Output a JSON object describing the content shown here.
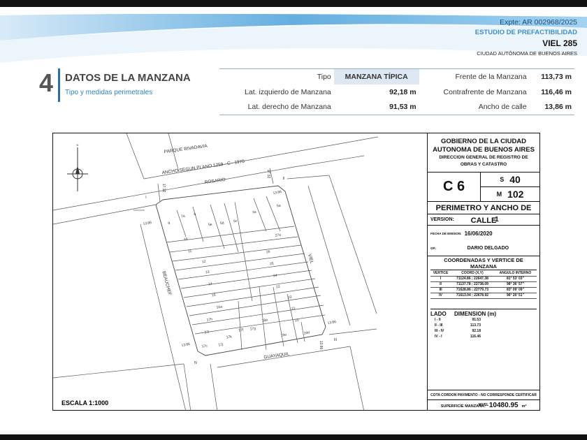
{
  "header": {
    "expediente": "Expte: AR 002968/2025",
    "estudio": "ESTUDIO DE PREFACTIBILIDAD",
    "direccion": "VIEL 285",
    "ciudad": "CIUDAD AUTÓNOMA DE BUENOS AIRES"
  },
  "section": {
    "number": "4",
    "title": "DATOS DE LA MANZANA",
    "subtitle": "Tipo y medidas perimetrales"
  },
  "datos": [
    {
      "label": "Tipo",
      "value": "MANZANA TÍPICA",
      "label2": "Frente de la Manzana",
      "value2": "113,73 m"
    },
    {
      "label": "Lat. izquierdo de Manzana",
      "value": "92,18 m",
      "label2": "Contrafrente de Manzana",
      "value2": "116,46 m"
    },
    {
      "label": "Lat. derecho de Manzana",
      "value": "91,53 m",
      "label2": "Ancho de calle",
      "value2": "13,86 m"
    }
  ],
  "plano": {
    "north": "N",
    "streets": {
      "parque": "PARQUE RIVADAVIA",
      "ancho": "ANCHO SEGUN PLANO 1259 - C - 1970",
      "rosario": "ROSARIO",
      "beauchef": "BEAUCHEF",
      "viel": "VIEL",
      "guayaquil": "GUAYAQUIL"
    },
    "dims": [
      "17.32",
      "17.32",
      "13.86",
      "13.86",
      "13.86",
      "13.86",
      "13.86"
    ],
    "vertices": [
      "I",
      "II",
      "III",
      "IV"
    ],
    "lots": [
      "9",
      "7a",
      "6",
      "5e",
      "5d",
      "5c",
      "3a",
      "5a",
      "27a",
      "10",
      "11",
      "26",
      "12",
      "25",
      "13",
      "24",
      "14",
      "23",
      "15",
      "22",
      "16a",
      "21",
      "17h",
      "18a",
      "20",
      "17i",
      "17f",
      "17g",
      "19a",
      "19d",
      "17k",
      "17c",
      "17j"
    ],
    "escala": "ESCALA 1:1000"
  },
  "cartouche": {
    "gob1": "GOBIERNO DE LA CIUDAD",
    "gob2": "AUTONOMA DE BUENOS AIRES",
    "dir1": "DIRECCION GENERAL DE REGISTRO DE",
    "dir2": "OBRAS Y CATASTRO",
    "circ": "C 6",
    "s_label": "S",
    "s": "40",
    "m_label": "M",
    "m": "102",
    "titulo": "PERIMETRO Y ANCHO DE CALLE",
    "version_label": "VERSION:",
    "version": "1",
    "fecha_label": "FECHA DE EMISION:",
    "fecha": "16/06/2020",
    "op_label": "OP.:",
    "op": "DARIO DELGADO",
    "coord_title": "COORDENADAS Y VERTICE DE MANZANA",
    "coord_headers": [
      "VERTICE",
      "COORD (X,Y)",
      "ANGULO INTERNO"
    ],
    "coords": [
      [
        "I",
        "71124.86 ; 22647.38",
        "81° 53' 03\""
      ],
      [
        "II",
        "71137.78 ; 22738.09",
        "98° 36' 57\""
      ],
      [
        "III",
        "71628.86 ; 22779.73",
        "83° 09' 09\""
      ],
      [
        "IV",
        "71613.04 ; 22678.92",
        "96° 20' 51\""
      ]
    ],
    "lado_label": "LADO",
    "dim_label": "DIMENSION (m)",
    "lados": [
      [
        "I - II",
        "91.53"
      ],
      [
        "II - III",
        "113.73"
      ],
      [
        "III - IV",
        "92.18"
      ],
      [
        "IV - I",
        "116.46"
      ]
    ],
    "cota": "COTA CORDON PAVIMENTO - NO CORRESPONDE CERTIFICAR NIVEL",
    "sup_label": "SUPERFICIE MANZANA:",
    "superficie": "10480.95",
    "sup_unit": "m²"
  }
}
